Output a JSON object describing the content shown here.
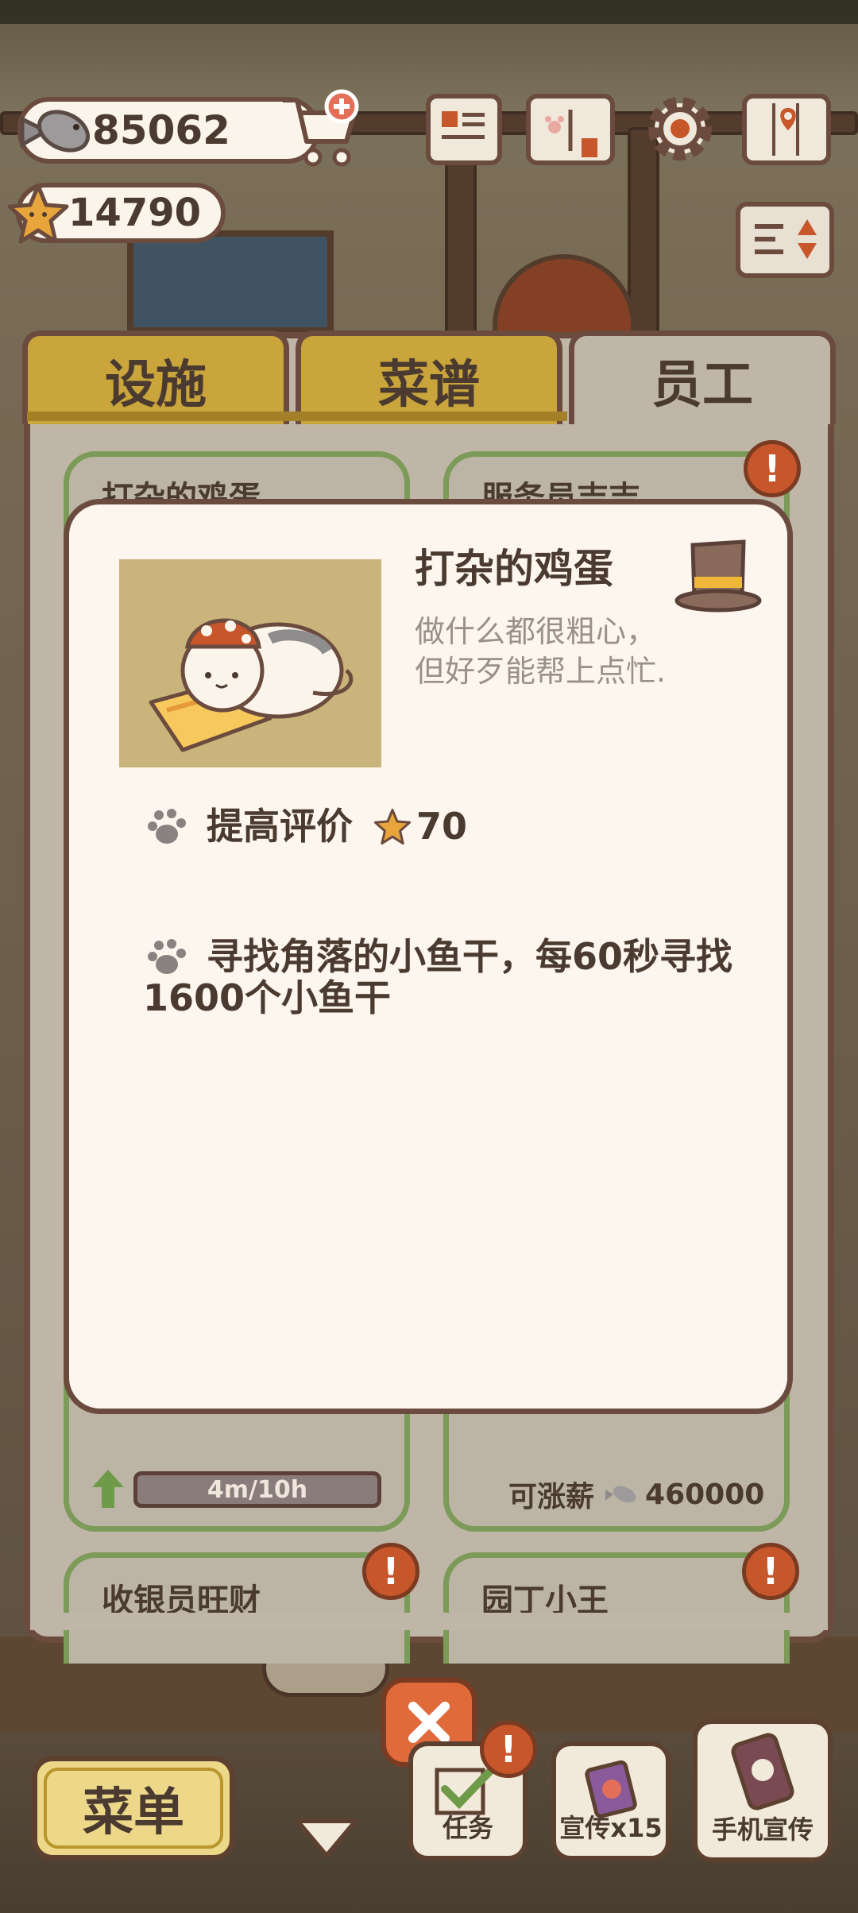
{
  "currency": {
    "fish": "85062",
    "stars": "14790"
  },
  "tabs": [
    {
      "label": "设施",
      "active": false
    },
    {
      "label": "菜谱",
      "active": false
    },
    {
      "label": "员工",
      "active": true
    }
  ],
  "cards": {
    "top_left_title": "打杂的鸡蛋",
    "top_right_title": "服务员吉吉",
    "progress_label": "4m/10h",
    "raise_label": "可涨薪",
    "raise_amount": "460000",
    "bottom_left_title": "收银员旺财",
    "bottom_right_title": "园丁小王",
    "badge_text": "!"
  },
  "popup": {
    "title": "打杂的鸡蛋",
    "desc_line1": "做什么都很粗心，",
    "desc_line2": "但好歹能帮上点忙.",
    "effect1_label": "提高评价",
    "effect1_value": "70",
    "effect2_line1": "寻找角落的小鱼干，每60秒寻找",
    "effect2_line2": "1600个小鱼干"
  },
  "bottom_bar": {
    "menu_label": "菜单",
    "task_label": "任务",
    "promo_label": "宣传x15",
    "phone_promo_label": "手机宣传"
  },
  "colors": {
    "accent_tab": "#c9a53b",
    "border_brown": "#6b4b3e",
    "badge_orange": "#c7562a",
    "card_border_green": "#7c9a58",
    "popup_bg": "#fcf6ee"
  }
}
